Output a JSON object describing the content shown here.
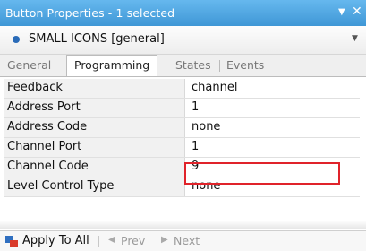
{
  "window": {
    "title": "Button Properties - 1 selected",
    "dropdown_icon": "triangle-down-icon",
    "close_icon": "close-icon"
  },
  "selector": {
    "value": "SMALL ICONS [general]",
    "dot_color": "#2a6bb8"
  },
  "tabs": [
    {
      "label": "General",
      "active": false
    },
    {
      "label": "Programming",
      "active": true
    },
    {
      "label": "States",
      "active": false
    },
    {
      "label": "Events",
      "active": false
    }
  ],
  "properties": [
    {
      "label": "Feedback",
      "value": "channel"
    },
    {
      "label": "Address Port",
      "value": "1"
    },
    {
      "label": "Address Code",
      "value": "none"
    },
    {
      "label": "Channel Port",
      "value": "1"
    },
    {
      "label": "Channel Code",
      "value": "9",
      "highlighted": true
    },
    {
      "label": "Level Control Type",
      "value": "none"
    }
  ],
  "bottom_bar": {
    "apply_label": "Apply To All",
    "prev_label": "Prev",
    "next_label": "Next"
  },
  "colors": {
    "titlebar": "#4aa3e0",
    "highlight_border": "#e0232a"
  }
}
